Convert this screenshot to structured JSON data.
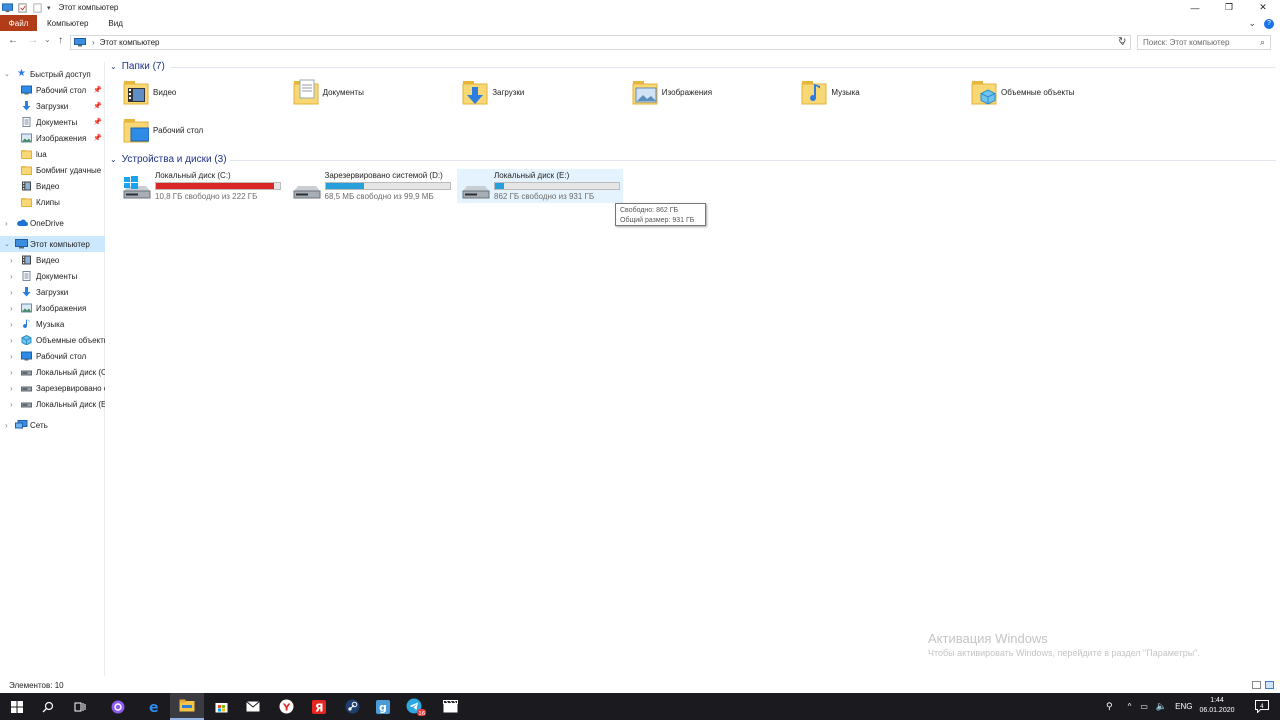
{
  "window": {
    "title": "Этот компьютер",
    "controls": {
      "minimize": "—",
      "maximize": "❐",
      "close": "✕"
    }
  },
  "ribbon": {
    "file": "Файл",
    "tabs": [
      "Компьютер",
      "Вид"
    ],
    "expand": "⌄",
    "help": "?"
  },
  "nav": {
    "back": "←",
    "forward": "→",
    "recent": "⌄",
    "up": "↑"
  },
  "address": {
    "separator": "›",
    "path": "Этот компьютер",
    "dropdown": "⌄",
    "refresh": "↻"
  },
  "search": {
    "placeholder": "Поиск: Этот компьютер",
    "icon": "⌕"
  },
  "navpane": {
    "quick_access": {
      "label": "Быстрый доступ",
      "items": [
        {
          "label": "Рабочий стол",
          "icon": "desktop-icon",
          "pinned": true
        },
        {
          "label": "Загрузки",
          "icon": "downloads-icon",
          "pinned": true
        },
        {
          "label": "Документы",
          "icon": "documents-icon",
          "pinned": true
        },
        {
          "label": "Изображения",
          "icon": "pictures-icon",
          "pinned": true
        },
        {
          "label": "lua",
          "icon": "folder-icon",
          "pinned": false
        },
        {
          "label": "Бомбинг удачные",
          "icon": "folder-icon",
          "pinned": false
        },
        {
          "label": "Видео",
          "icon": "video-icon",
          "pinned": false
        },
        {
          "label": "Клипы",
          "icon": "folder-icon",
          "pinned": false
        }
      ]
    },
    "onedrive": "OneDrive",
    "this_pc": {
      "label": "Этот компьютер",
      "items": [
        {
          "label": "Видео",
          "icon": "video-icon"
        },
        {
          "label": "Документы",
          "icon": "documents-icon"
        },
        {
          "label": "Загрузки",
          "icon": "downloads-icon"
        },
        {
          "label": "Изображения",
          "icon": "pictures-icon"
        },
        {
          "label": "Музыка",
          "icon": "music-icon"
        },
        {
          "label": "Объемные объекты",
          "icon": "3d-objects-icon"
        },
        {
          "label": "Рабочий стол",
          "icon": "desktop-icon"
        },
        {
          "label": "Локальный диск (C:)",
          "icon": "drive-icon"
        },
        {
          "label": "Зарезервировано системой (D:)",
          "icon": "drive-icon"
        },
        {
          "label": "Локальный диск (E:)",
          "icon": "drive-icon"
        }
      ]
    },
    "network": "Сеть"
  },
  "content": {
    "folders_header": "Папки (7)",
    "folders": [
      {
        "label": "Видео",
        "icon": "video-folder-icon"
      },
      {
        "label": "Документы",
        "icon": "documents-folder-icon"
      },
      {
        "label": "Загрузки",
        "icon": "downloads-folder-icon"
      },
      {
        "label": "Изображения",
        "icon": "pictures-folder-icon"
      },
      {
        "label": "Музыка",
        "icon": "music-folder-icon"
      },
      {
        "label": "Объемные объекты",
        "icon": "3d-objects-folder-icon"
      },
      {
        "label": "Рабочий стол",
        "icon": "desktop-folder-icon"
      }
    ],
    "drives_header": "Устройства и диски (3)",
    "drives": [
      {
        "label": "Локальный диск (C:)",
        "free_text": "10,8 ГБ свободно из 222 ГБ",
        "used_fraction": 0.951,
        "bar_color": "#da2626"
      },
      {
        "label": "Зарезервировано системой (D:)",
        "free_text": "68,5 МБ свободно из 99,9 МБ",
        "used_fraction": 0.314,
        "bar_color": "#26a0da"
      },
      {
        "label": "Локальный диск (E:)",
        "free_text": "862 ГБ свободно из 931 ГБ",
        "used_fraction": 0.074,
        "bar_color": "#26a0da"
      }
    ],
    "tooltip": {
      "line1": "Свободно: 862 ГБ",
      "line2": "Общий размер: 931 ГБ"
    }
  },
  "watermark": {
    "title": "Активация Windows",
    "subtitle": "Чтобы активировать Windows, перейдите в раздел \"Параметры\"."
  },
  "status": {
    "count": "Элементов: 10"
  },
  "taskbar": {
    "apps": [
      "start-icon",
      "search-icon",
      "task-view-icon",
      "cortana-icon",
      "edge-icon",
      "file-explorer-icon",
      "store-icon",
      "mail-icon",
      "yandex-browser-icon",
      "yandex-icon",
      "steam-icon",
      "gog-icon",
      "telegram-icon",
      "video-editor-icon"
    ],
    "telegram_badge": "16",
    "tray": {
      "language": "ENG",
      "time": "1:44",
      "date": "06.01.2020",
      "notifications": "4"
    }
  },
  "colors": {
    "file_tab": "#b23c17",
    "selection": "#cce8ff",
    "group_header": "#1e3287",
    "taskbar": "#1b1a1f"
  }
}
